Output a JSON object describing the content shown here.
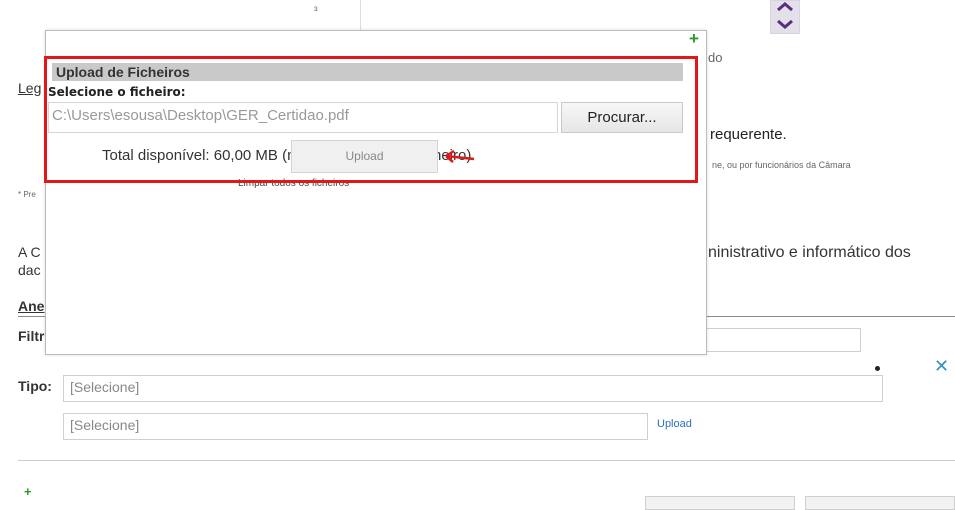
{
  "background": {
    "field_label_fragment": "do",
    "requester_fragment": "requerente.",
    "note_fragment": "ne, ou por funcionários da Câmara",
    "leg_fragment": "Leg",
    "pre_fragment": "* Pre",
    "ac_fragment": "A C",
    "dac_fragment": "dac",
    "admin_fragment": "ninistrativo e informático dos",
    "anexos_fragment": "Ane",
    "filtro_fragment": "Filtr",
    "tipo_label": "Tipo:",
    "tipo_select_1": "[Selecione]",
    "tipo_select_2": "[Selecione]",
    "upload_link": "Upload",
    "top_fragment": "ɜ",
    "add_icon_bottom": "+"
  },
  "modal": {
    "total_text": "Total disponível: 60,00 MB (máx. 10,00 MB por ficheiro)",
    "clear_link": "Limpar todos os ficheiros",
    "add_icon": "+"
  },
  "upload_panel": {
    "title": "Upload de Ficheiros",
    "select_label": "Selecione o ficheiro:",
    "file_path": "C:\\Users\\esousa\\Desktop\\GER_Certidao.pdf",
    "browse_button": "Procurar...",
    "upload_button": "Upload"
  },
  "colors": {
    "highlight": "#e01818",
    "accent_link": "#2a6fbf",
    "add_green": "#2a9a2a"
  }
}
